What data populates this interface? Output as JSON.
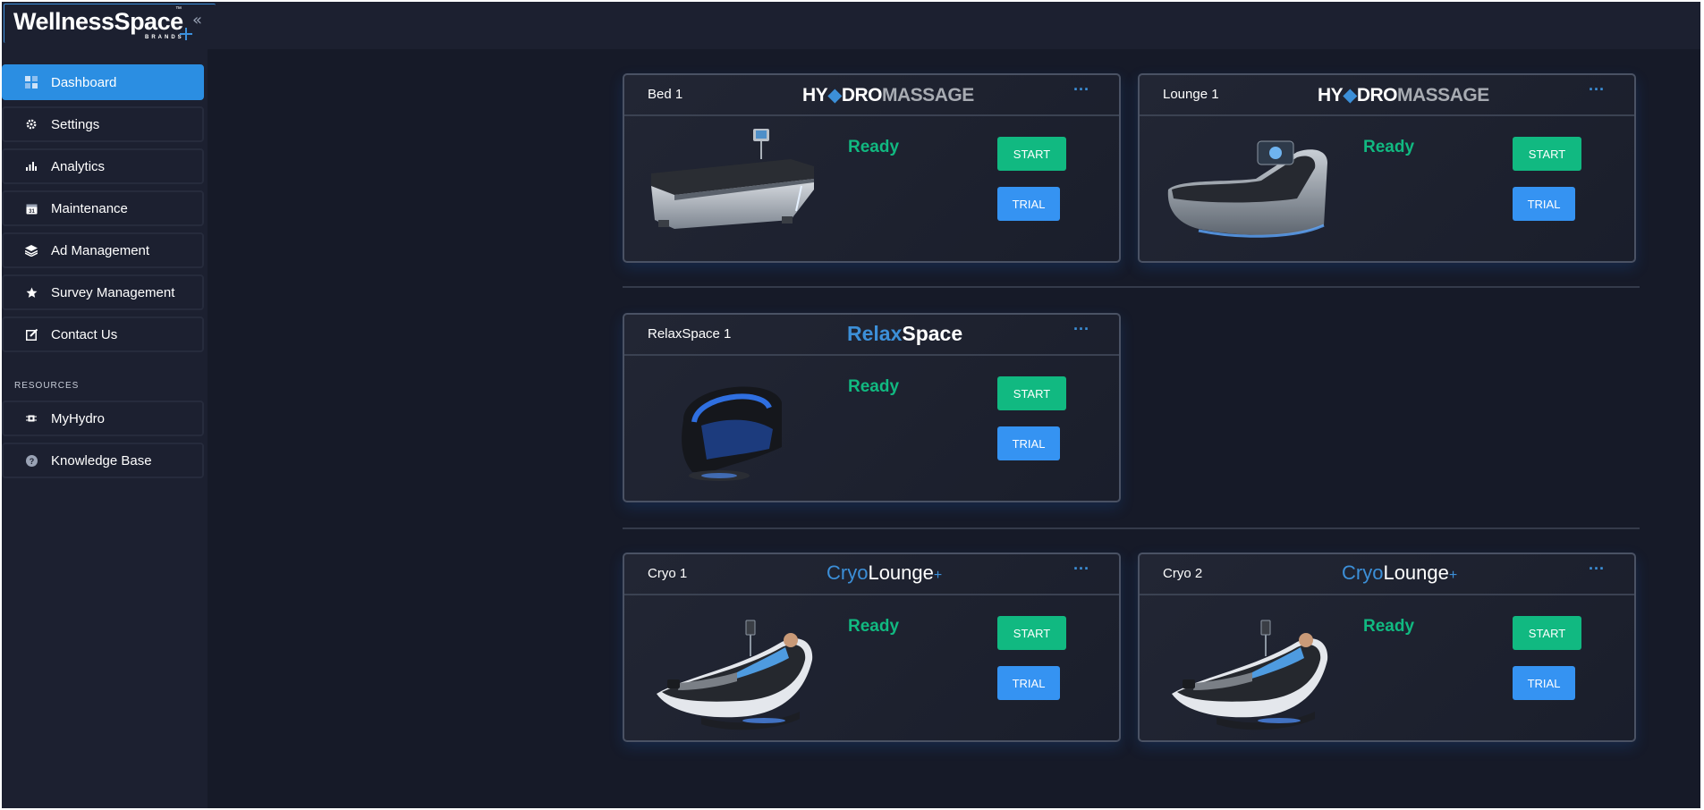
{
  "logo": {
    "text": "WellnessSpace",
    "tm": "™",
    "sub": "BRANDS"
  },
  "sidebar": {
    "items": [
      {
        "label": "Dashboard",
        "icon": "dashboard-icon",
        "active": true
      },
      {
        "label": "Settings",
        "icon": "gear-icon"
      },
      {
        "label": "Analytics",
        "icon": "bar-chart-icon"
      },
      {
        "label": "Maintenance",
        "icon": "calendar-icon",
        "icon_text": "31"
      },
      {
        "label": "Ad Management",
        "icon": "layers-icon"
      },
      {
        "label": "Survey Management",
        "icon": "star-icon"
      },
      {
        "label": "Contact Us",
        "icon": "edit-icon"
      }
    ],
    "resources_label": "RESOURCES",
    "resources": [
      {
        "label": "MyHydro",
        "icon": "chip-icon"
      },
      {
        "label": "Knowledge Base",
        "icon": "help-icon",
        "icon_text": "?"
      }
    ]
  },
  "colors": {
    "accent": "#2b8ee2",
    "ready": "#11b981",
    "start": "#11b981",
    "trial": "#3593f2",
    "background": "#161a28",
    "sidebar": "#1c2030"
  },
  "cards": [
    {
      "name": "Bed 1",
      "brand": [
        "HY",
        "DRO",
        "MASSAGE"
      ],
      "brand_type": "hydro",
      "status": "Ready",
      "start": "START",
      "trial": "TRIAL",
      "more": "···",
      "device": "hydromassage-bed"
    },
    {
      "name": "Lounge 1",
      "brand": [
        "HY",
        "DRO",
        "MASSAGE"
      ],
      "brand_type": "hydro",
      "status": "Ready",
      "start": "START",
      "trial": "TRIAL",
      "more": "···",
      "device": "hydromassage-lounge"
    },
    {
      "name": "RelaxSpace 1",
      "brand": [
        "Relax",
        "Space"
      ],
      "brand_type": "relax",
      "status": "Ready",
      "start": "START",
      "trial": "TRIAL",
      "more": "···",
      "device": "relaxspace-pod"
    },
    {
      "name": "Cryo 1",
      "brand": [
        "Cryo",
        "Lounge",
        "+"
      ],
      "brand_type": "cryo",
      "status": "Ready",
      "start": "START",
      "trial": "TRIAL",
      "more": "···",
      "device": "cryolounge-chair"
    },
    {
      "name": "Cryo 2",
      "brand": [
        "Cryo",
        "Lounge",
        "+"
      ],
      "brand_type": "cryo",
      "status": "Ready",
      "start": "START",
      "trial": "TRIAL",
      "more": "···",
      "device": "cryolounge-chair"
    }
  ]
}
